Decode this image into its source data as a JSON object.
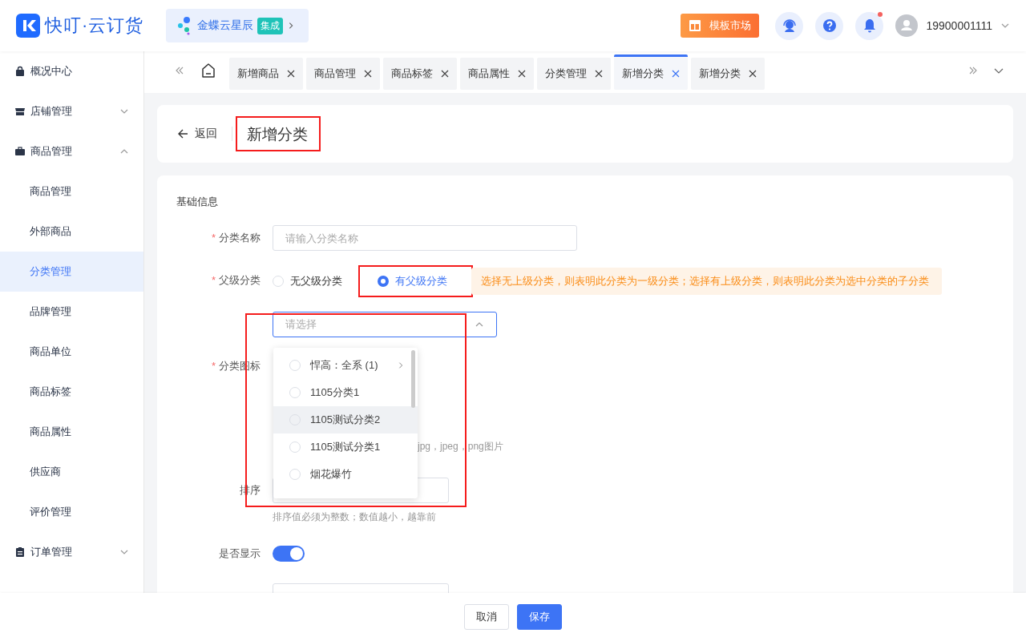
{
  "header": {
    "logo_text": "快叮·云订货",
    "integration": {
      "name": "金蝶云星辰",
      "tag": "集成"
    },
    "template_button": "模板市场",
    "notification_dot": true,
    "user": "19900001111"
  },
  "sidebar": {
    "items": [
      {
        "label": "概况中心"
      },
      {
        "label": "店铺管理",
        "expanded": false
      },
      {
        "label": "商品管理",
        "expanded": true,
        "children": [
          {
            "label": "商品管理",
            "selected": false
          },
          {
            "label": "外部商品",
            "selected": false
          },
          {
            "label": "分类管理",
            "selected": true
          },
          {
            "label": "品牌管理",
            "selected": false
          },
          {
            "label": "商品单位",
            "selected": false
          },
          {
            "label": "商品标签",
            "selected": false
          },
          {
            "label": "商品属性",
            "selected": false
          },
          {
            "label": "供应商",
            "selected": false
          },
          {
            "label": "评价管理",
            "selected": false
          }
        ]
      },
      {
        "label": "订单管理",
        "expanded": false
      }
    ]
  },
  "tabs": [
    {
      "label": "新增商品",
      "selected": false
    },
    {
      "label": "商品管理",
      "selected": false
    },
    {
      "label": "商品标签",
      "selected": false
    },
    {
      "label": "商品属性",
      "selected": false
    },
    {
      "label": "分类管理",
      "selected": false
    },
    {
      "label": "新增分类",
      "selected": true
    },
    {
      "label": "新增分类",
      "selected": false
    }
  ],
  "page": {
    "back": "返回",
    "title": "新增分类",
    "title_highlighted": true
  },
  "form": {
    "section": "基础信息",
    "name": {
      "label": "分类名称",
      "required_mark": "*",
      "placeholder": "请输入分类名称"
    },
    "parent": {
      "label": "父级分类",
      "required_mark": "*",
      "options": [
        {
          "label": "无父级分类",
          "selected": false,
          "highlighted": false
        },
        {
          "label": "有父级分类",
          "selected": true,
          "highlighted": true
        }
      ],
      "hint": "选择无上级分类，则表明此分类为一级分类；选择有上级分类，则表明此分类为选中分类的子分类",
      "select": {
        "placeholder": "请选择",
        "open": true,
        "highlighted": true,
        "options": [
          {
            "label": "悍高：全系 (1)",
            "selected": false,
            "hovered": false,
            "has_children": true
          },
          {
            "label": "1105分类1",
            "selected": false,
            "hovered": false,
            "has_children": false
          },
          {
            "label": "1105测试分类2",
            "selected": false,
            "hovered": true,
            "has_children": false
          },
          {
            "label": "1105测试分类1",
            "selected": false,
            "hovered": false,
            "has_children": false
          },
          {
            "label": "烟花爆竹",
            "selected": false,
            "hovered": false,
            "has_children": false
          }
        ]
      }
    },
    "icon": {
      "label": "分类图标",
      "required_mark": "*",
      "hint": "jpg，jpeg，png图片"
    },
    "sort": {
      "label": "排序",
      "hint": "排序值必须为整数；数值越小，越靠前"
    },
    "visible": {
      "label": "是否显示",
      "on": true
    }
  },
  "footer": {
    "buttons": [
      {
        "label": "取消",
        "kind": "default"
      },
      {
        "label": "保存",
        "kind": "primary"
      }
    ]
  }
}
